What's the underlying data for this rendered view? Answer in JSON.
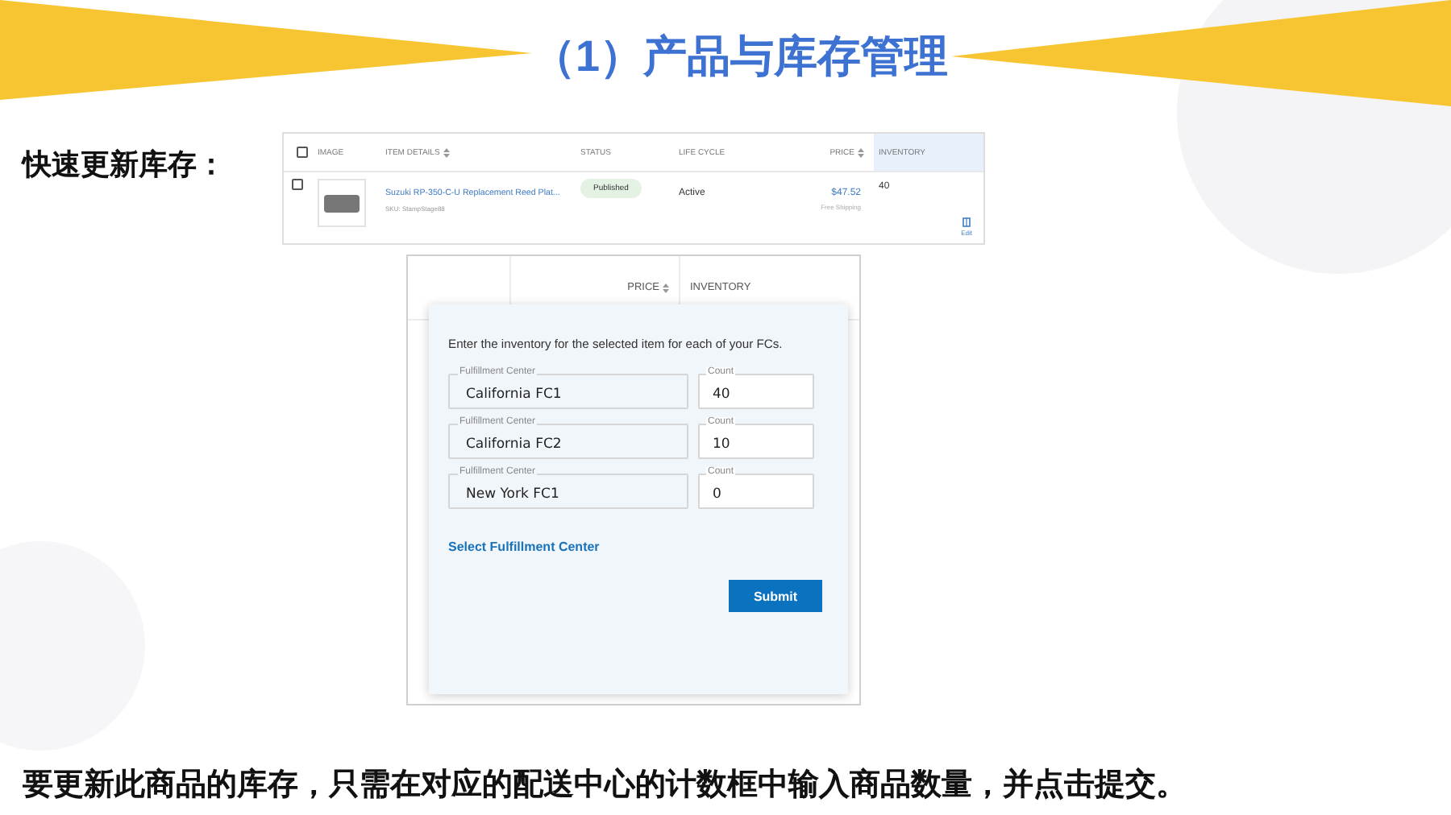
{
  "title": "（1）产品与库存管理",
  "section_label": "快速更新库存：",
  "listing_table": {
    "header_checked": false,
    "columns": [
      {
        "label": "IMAGE",
        "sortable": false
      },
      {
        "label": "ITEM DETAILS",
        "sortable": true
      },
      {
        "label": "STATUS",
        "sortable": false
      },
      {
        "label": "LIFE CYCLE",
        "sortable": false
      },
      {
        "label": "PRICE",
        "sortable": true
      },
      {
        "label": "INVENTORY",
        "sortable": false
      }
    ],
    "rows": [
      {
        "checked": false,
        "item_title": "Suzuki RP-350-C-U Replacement Reed Plat...",
        "sku": "SKU: StampStage88",
        "status": "Published",
        "life_cycle": "Active",
        "price": "$47.52",
        "shipping": "Free Shipping",
        "inventory": "40",
        "edit_label": "Edit"
      }
    ]
  },
  "inventory_dialog": {
    "columns": [
      {
        "label": "PRICE",
        "sortable": true
      },
      {
        "label": "INVENTORY",
        "sortable": false
      }
    ],
    "instruction": "Enter the inventory for the selected item for each of your FCs.",
    "rows": [
      {
        "center_label": "Fulfillment Center",
        "center": "California FC1",
        "count_label": "Count",
        "count": "40"
      },
      {
        "center_label": "Fulfillment Center",
        "center": "California FC2",
        "count_label": "Count",
        "count": "10"
      },
      {
        "center_label": "Fulfillment Center",
        "center": "New York FC1",
        "count_label": "Count",
        "count": "0"
      }
    ],
    "link": "Select Fulfillment Center",
    "submit": "Submit"
  },
  "caption": "要更新此商品的库存，只需在对应的配送中心的计数框中输入商品数量，并点击提交。"
}
